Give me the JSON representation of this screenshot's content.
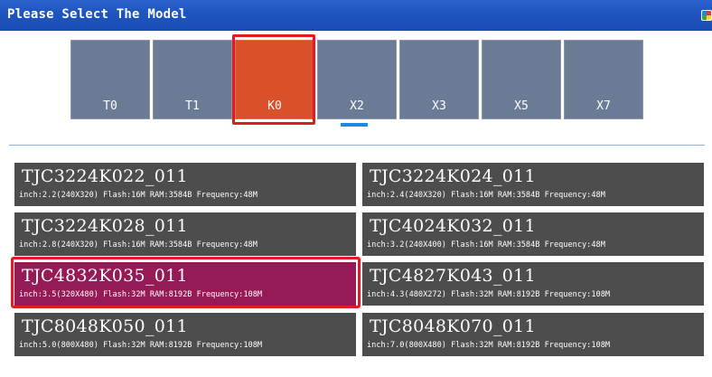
{
  "window": {
    "title": "Please Select The Model"
  },
  "tabs": [
    {
      "label": "T0"
    },
    {
      "label": "T1"
    },
    {
      "label": "K0"
    },
    {
      "label": "X2"
    },
    {
      "label": "X3"
    },
    {
      "label": "X5"
    },
    {
      "label": "X7"
    }
  ],
  "active_tab": "K0",
  "models": [
    {
      "name": "TJC3224K022_011",
      "spec": "inch:2.2(240X320) Flash:16M RAM:3584B Frequency:48M"
    },
    {
      "name": "TJC3224K024_011",
      "spec": "inch:2.4(240X320) Flash:16M RAM:3584B Frequency:48M"
    },
    {
      "name": "TJC3224K028_011",
      "spec": "inch:2.8(240X320) Flash:16M RAM:3584B Frequency:48M"
    },
    {
      "name": "TJC4024K032_011",
      "spec": "inch:3.2(240X400) Flash:16M RAM:3584B Frequency:48M"
    },
    {
      "name": "TJC4832K035_011",
      "spec": "inch:3.5(320X480) Flash:32M RAM:8192B Frequency:108M"
    },
    {
      "name": "TJC4827K043_011",
      "spec": "inch:4.3(480X272) Flash:32M RAM:8192B Frequency:108M"
    },
    {
      "name": "TJC8048K050_011",
      "spec": "inch:5.0(800X480) Flash:32M RAM:8192B Frequency:108M"
    },
    {
      "name": "TJC8048K070_011",
      "spec": "inch:7.0(800X480) Flash:32M RAM:8192B Frequency:108M"
    }
  ],
  "selected_model": "TJC4832K035_011",
  "colors": {
    "title_bar": "#1e54bd",
    "tab_bg": "#6b7a95",
    "tab_active": "#d9502a",
    "card_bg": "#4d4d4d",
    "card_selected": "#951a56",
    "highlight_border": "#e01b24",
    "underline": "#1e88e5"
  },
  "icons": {
    "app": "app-icon"
  }
}
